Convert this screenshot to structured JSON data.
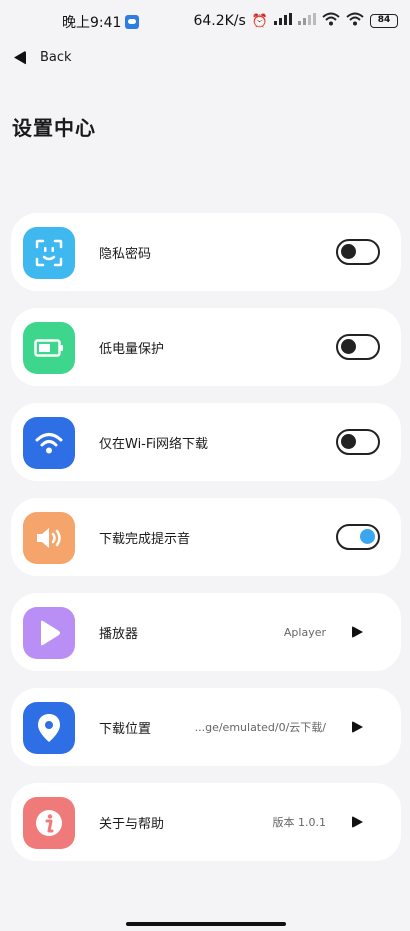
{
  "status_bar": {
    "time": "晚上9:41",
    "network_speed": "64.2K/s",
    "battery": "84"
  },
  "nav": {
    "back_label": "Back"
  },
  "page": {
    "title": "设置中心"
  },
  "settings": [
    {
      "label": "隐私密码",
      "type": "toggle",
      "enabled": false,
      "icon": "privacy-face-icon",
      "color": "#3fb8f0"
    },
    {
      "label": "低电量保护",
      "type": "toggle",
      "enabled": false,
      "icon": "battery-icon",
      "color": "#3dd68c"
    },
    {
      "label": "仅在Wi-Fi网络下载",
      "type": "toggle",
      "enabled": false,
      "icon": "wifi-icon",
      "color": "#2f6fe6"
    },
    {
      "label": "下载完成提示音",
      "type": "toggle",
      "enabled": true,
      "icon": "speaker-icon",
      "color": "#f5a46b"
    },
    {
      "label": "播放器",
      "type": "link",
      "value": "Aplayer",
      "icon": "play-icon",
      "color": "#b98ef5"
    },
    {
      "label": "下载位置",
      "type": "link",
      "value": "...ge/emulated/0/云下载/",
      "icon": "location-pin-icon",
      "color": "#2f6fe6"
    },
    {
      "label": "关于与帮助",
      "type": "link",
      "value": "版本 1.0.1",
      "icon": "info-icon",
      "color": "#f07a7a"
    }
  ]
}
